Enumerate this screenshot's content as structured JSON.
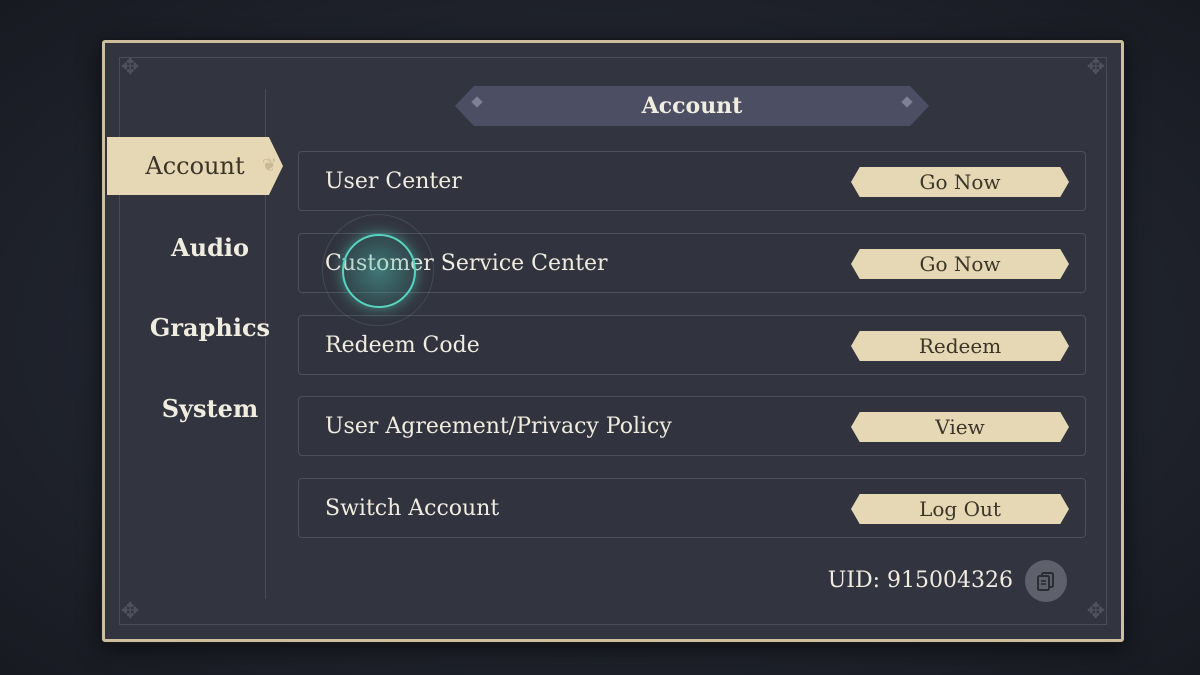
{
  "header": {
    "title": "Account"
  },
  "sidebar": {
    "items": [
      {
        "label": "Account",
        "active": true
      },
      {
        "label": "Audio",
        "active": false
      },
      {
        "label": "Graphics",
        "active": false
      },
      {
        "label": "System",
        "active": false
      }
    ]
  },
  "rows": [
    {
      "label": "User Center",
      "button": "Go Now"
    },
    {
      "label": "Customer Service Center",
      "button": "Go Now"
    },
    {
      "label": "Redeem Code",
      "button": "Redeem"
    },
    {
      "label": "User Agreement/Privacy Policy",
      "button": "View"
    },
    {
      "label": "Switch Account",
      "button": "Log Out"
    }
  ],
  "uid": {
    "text": "UID: 915004326"
  },
  "icons": {
    "copy": "copy-icon"
  },
  "colors": {
    "accent": "#e6d8b5",
    "panel": "#32353f",
    "border": "#cdbf9c",
    "tap": "#58d4c2"
  }
}
